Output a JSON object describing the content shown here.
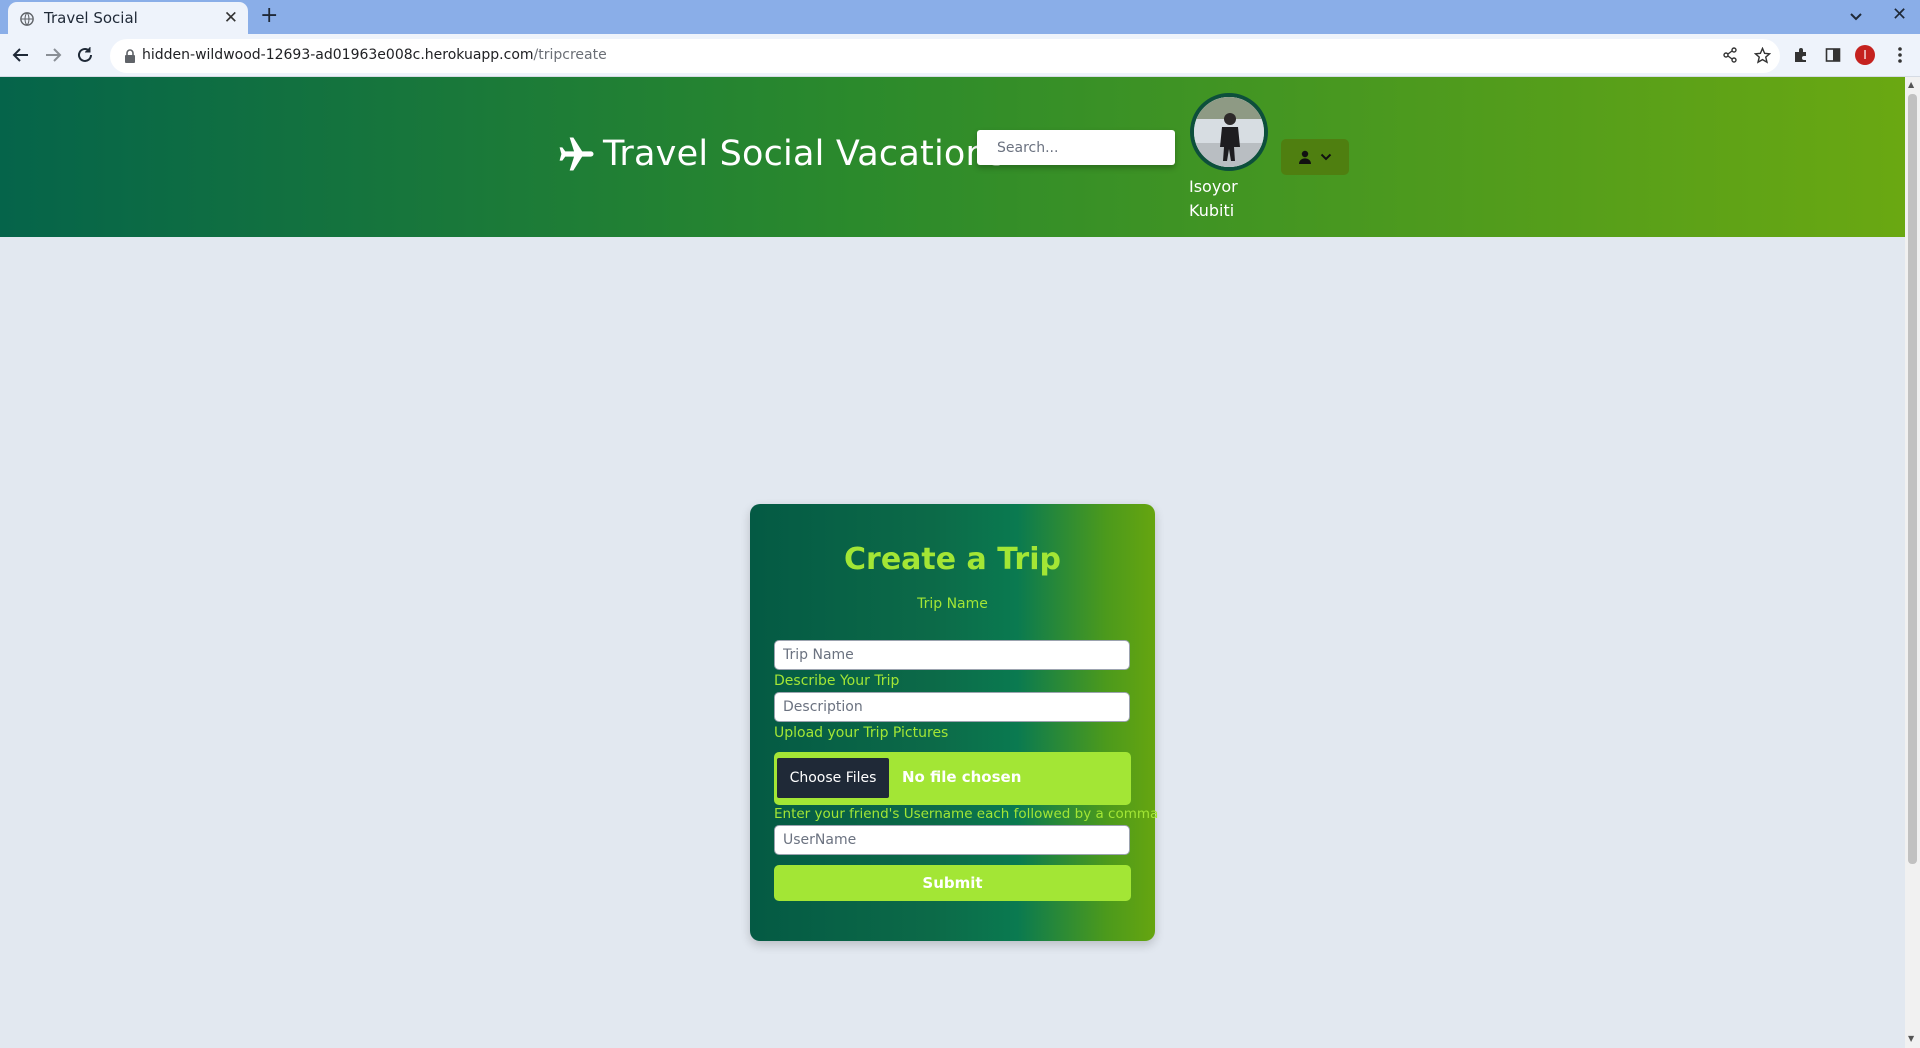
{
  "browser": {
    "tab_title": "Travel Social",
    "url_host": "hidden-wildwood-12693-ad01963e008c.herokuapp.com",
    "url_path": "/tripcreate",
    "profile_initial": "I"
  },
  "header": {
    "brand_title": "Travel Social Vacations",
    "brand_icon": "airplane-icon",
    "search_placeholder": "Search...",
    "user_name": "Isoyor Kubiti"
  },
  "form": {
    "title": "Create a Trip",
    "trip_name_label": "Trip Name",
    "trip_name_placeholder": "Trip Name",
    "description_label": "Describe Your Trip",
    "description_placeholder": "Description",
    "upload_label": "Upload your Trip Pictures",
    "choose_files_label": "Choose Files",
    "file_status": "No file chosen",
    "friends_label": "Enter your friend's Username each followed by a comma",
    "username_placeholder": "UserName",
    "submit_label": "Submit"
  },
  "colors": {
    "header_start": "#05644a",
    "header_end": "#6aa812",
    "accent": "#a3e635",
    "page_bg": "#e2e8f0"
  }
}
